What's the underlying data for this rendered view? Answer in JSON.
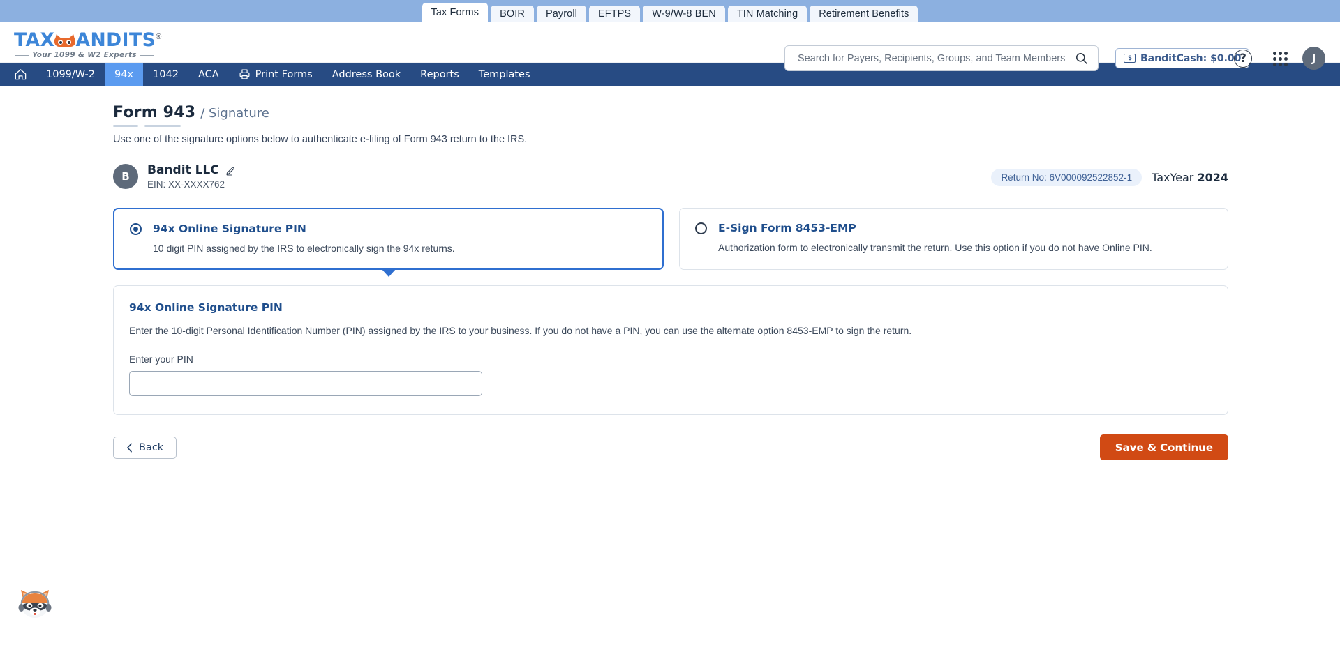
{
  "product_tabs": [
    {
      "label": "Tax Forms",
      "active": true
    },
    {
      "label": "BOIR",
      "active": false
    },
    {
      "label": "Payroll",
      "active": false
    },
    {
      "label": "EFTPS",
      "active": false
    },
    {
      "label": "W-9/W-8 BEN",
      "active": false
    },
    {
      "label": "TIN Matching",
      "active": false
    },
    {
      "label": "Retirement Benefits",
      "active": false
    }
  ],
  "logo": {
    "text_left": "TAX",
    "text_right": "ANDITS",
    "registered": "®",
    "tagline": "Your 1099 & W2 Experts"
  },
  "search": {
    "placeholder": "Search for Payers, Recipients, Groups, and Team Members",
    "value": "",
    "icon": "search-icon"
  },
  "header_right": {
    "bandit_cash_label": "BanditCash: $0.00",
    "cash_icon_glyph": "$",
    "help_glyph": "?",
    "avatar_initial": "J"
  },
  "main_nav": [
    {
      "label": "",
      "icon": "home-icon",
      "active": false
    },
    {
      "label": "1099/W-2",
      "active": false
    },
    {
      "label": "94x",
      "active": true
    },
    {
      "label": "1042",
      "active": false
    },
    {
      "label": "ACA",
      "active": false
    },
    {
      "label": "Print Forms",
      "icon": "printer-icon",
      "active": false
    },
    {
      "label": "Address Book",
      "active": false
    },
    {
      "label": "Reports",
      "active": false
    },
    {
      "label": "Templates",
      "active": false
    }
  ],
  "page": {
    "title_main": "Form 943",
    "title_sub": "/ Signature",
    "subtitle": "Use one of the signature options below to authenticate e-filing of Form 943 return to the IRS."
  },
  "business": {
    "avatar_initial": "B",
    "name": "Bandit LLC",
    "ein": "EIN: XX-XXXX762",
    "edit_icon": "edit-pencil-icon"
  },
  "return_info": {
    "return_no": "Return No: 6V000092522852-1",
    "tax_year_label": "TaxYear",
    "tax_year_value": "2024"
  },
  "options": [
    {
      "title": "94x Online Signature PIN",
      "description": "10 digit PIN assigned by the IRS to electronically sign the 94x returns.",
      "selected": true
    },
    {
      "title": "E-Sign Form 8453-EMP",
      "description": "Authorization form to electronically transmit the return. Use this option if you do not have Online PIN.",
      "selected": false
    }
  ],
  "pin_panel": {
    "title": "94x Online Signature PIN",
    "description": "Enter the 10-digit Personal Identification Number (PIN) assigned by the IRS to your business. If you do not have a PIN, you can use the alternate option 8453-EMP to sign the return.",
    "field_label": "Enter your PIN",
    "field_value": "",
    "field_placeholder": ""
  },
  "footer": {
    "back_label": "Back",
    "back_icon": "chevron-left-icon",
    "save_label": "Save & Continue"
  },
  "mascot": {
    "name": "bandit-mascot-icon"
  },
  "colors": {
    "top_strip": "#8cb0e0",
    "nav_blue": "#274b83",
    "nav_active": "#5b9bf0",
    "accent_orange": "#d14a14",
    "link_blue": "#1f4e8c",
    "selected_border": "#2f6fd0"
  }
}
